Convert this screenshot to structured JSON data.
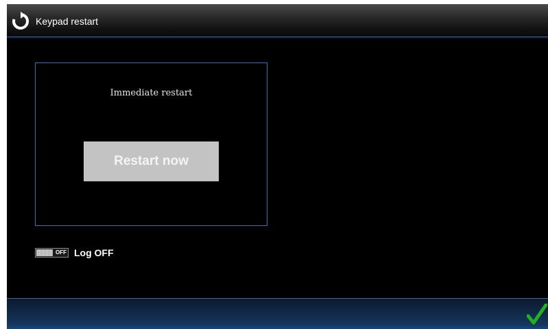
{
  "window": {
    "title": "Keypad restart",
    "icon": "restart-icon"
  },
  "panel": {
    "label": "Immediate restart",
    "button_label": "Restart now"
  },
  "logoff": {
    "toggle_state": "OFF",
    "label": "Log OFF"
  },
  "footer": {
    "confirm_icon": "checkmark-icon"
  },
  "colors": {
    "background": "#000000",
    "accent_border": "#3f6fa8",
    "button_bg": "#c3c3c3",
    "confirm_green": "#22b022"
  }
}
